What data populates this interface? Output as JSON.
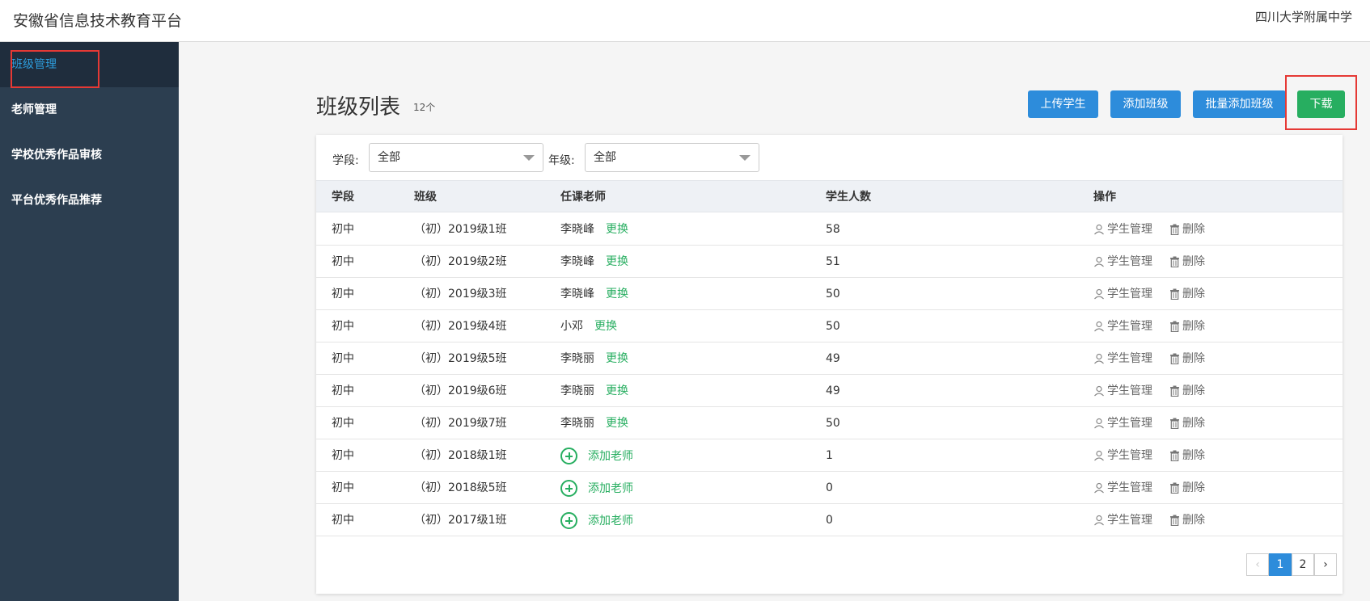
{
  "header": {
    "title": "安徽省信息技术教育平台",
    "school": "四川大学附属中学"
  },
  "sidebar": {
    "items": [
      {
        "label": "班级管理"
      },
      {
        "label": "老师管理"
      },
      {
        "label": "学校优秀作品审核"
      },
      {
        "label": "平台优秀作品推荐"
      }
    ]
  },
  "page": {
    "title": "班级列表",
    "count": "12个"
  },
  "toolbar": {
    "upload_label": "上传学生",
    "add_class_label": "添加班级",
    "batch_add_label": "批量添加班级",
    "download_label": "下载"
  },
  "filters": {
    "stage_label": "学段:",
    "stage_value": "全部",
    "grade_label": "年级:",
    "grade_value": "全部"
  },
  "table": {
    "headers": [
      "学段",
      "班级",
      "任课老师",
      "学生人数",
      "操作"
    ],
    "rows": [
      {
        "stage": "初中",
        "class": "（初）2019级1班",
        "teacher": "李晓峰",
        "count": "58"
      },
      {
        "stage": "初中",
        "class": "（初）2019级2班",
        "teacher": "李晓峰",
        "count": "51"
      },
      {
        "stage": "初中",
        "class": "（初）2019级3班",
        "teacher": "李晓峰",
        "count": "50"
      },
      {
        "stage": "初中",
        "class": "（初）2019级4班",
        "teacher": "小邓",
        "count": "50"
      },
      {
        "stage": "初中",
        "class": "（初）2019级5班",
        "teacher": "李晓丽",
        "count": "49"
      },
      {
        "stage": "初中",
        "class": "（初）2019级6班",
        "teacher": "李晓丽",
        "count": "49"
      },
      {
        "stage": "初中",
        "class": "（初）2019级7班",
        "teacher": "李晓丽",
        "count": "50"
      },
      {
        "stage": "初中",
        "class": "（初）2018级1班",
        "teacher": "",
        "count": "1"
      },
      {
        "stage": "初中",
        "class": "（初）2018级5班",
        "teacher": "",
        "count": "0"
      },
      {
        "stage": "初中",
        "class": "（初）2017级1班",
        "teacher": "",
        "count": "0"
      }
    ],
    "change_label": "更换",
    "add_teacher_label": "添加老师",
    "manage_label": "学生管理",
    "delete_label": "删除"
  },
  "pagination": {
    "prev": "‹",
    "pages": [
      "1",
      "2"
    ],
    "next": "›",
    "current": "1"
  },
  "colors": {
    "sidebar_bg": "#2c3e50",
    "accent_blue": "#2d8cdb",
    "accent_green": "#27ae60",
    "highlight_red": "#e53935"
  }
}
